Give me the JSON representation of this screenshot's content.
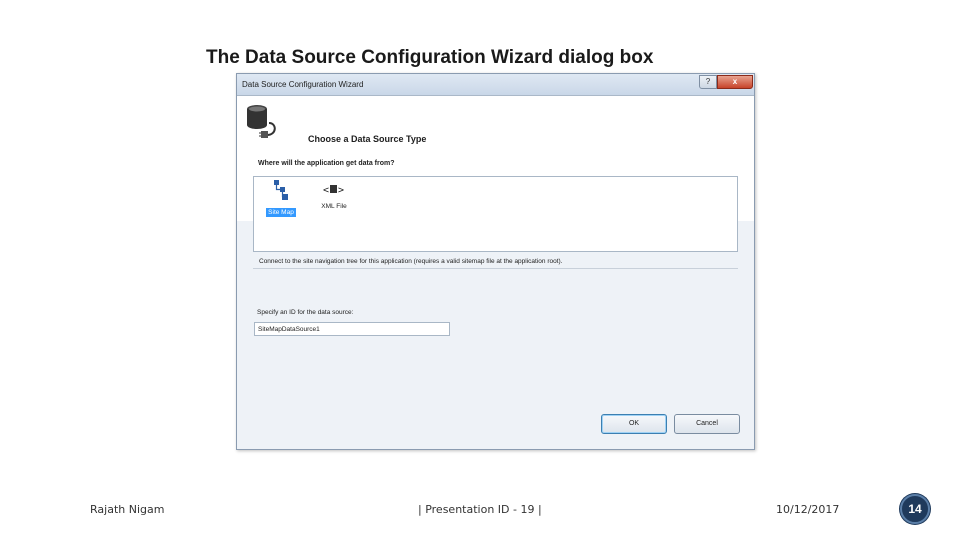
{
  "slide": {
    "title": "The Data Source Configuration Wizard dialog box"
  },
  "dialog": {
    "title": "Data Source Configuration Wizard",
    "help_glyph": "?",
    "close_glyph": "x",
    "header_title": "Choose a Data Source Type",
    "question": "Where will the application get data from?",
    "source_types": [
      {
        "label": "Site Map",
        "icon": "sitemap-icon",
        "selected": true
      },
      {
        "label": "XML File",
        "icon": "xml-file-icon",
        "selected": false
      }
    ],
    "description": "Connect to the site navigation tree for this application (requires a valid sitemap file at the application root).",
    "id_label": "Specify an ID for the data source:",
    "id_value": "SiteMapDataSource1",
    "ok_label": "OK",
    "cancel_label": "Cancel"
  },
  "footer": {
    "author": "Rajath Nigam",
    "center": "| Presentation ID - 19 |",
    "date": "10/12/2017",
    "page": "14"
  },
  "colors": {
    "selection": "#3399ff",
    "badge": "#1f3a5c"
  }
}
